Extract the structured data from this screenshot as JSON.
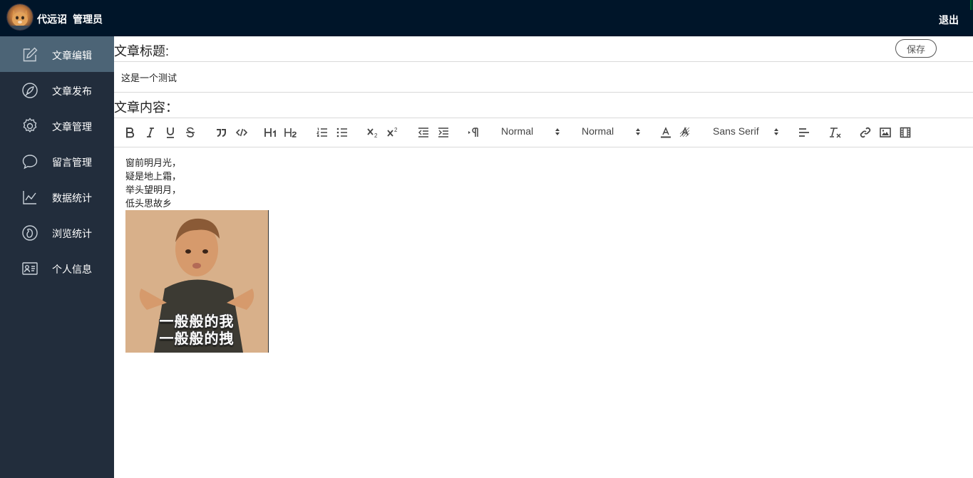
{
  "header": {
    "user_name": "代远诏",
    "user_role": "管理员",
    "logout_label": "退出"
  },
  "sidebar": {
    "items": [
      {
        "label": "文章编辑",
        "icon": "edit-icon",
        "active": true
      },
      {
        "label": "文章发布",
        "icon": "publish-icon",
        "active": false
      },
      {
        "label": "文章管理",
        "icon": "gear-icon",
        "active": false
      },
      {
        "label": "留言管理",
        "icon": "comment-icon",
        "active": false
      },
      {
        "label": "数据统计",
        "icon": "line-chart-icon",
        "active": false
      },
      {
        "label": "浏览统计",
        "icon": "footprint-icon",
        "active": false
      },
      {
        "label": "个人信息",
        "icon": "id-card-icon",
        "active": false
      }
    ]
  },
  "main": {
    "title_label": "文章标题:",
    "save_label": "保存",
    "title_value": "这是一个测试",
    "content_label": "文章内容：",
    "toolbar": {
      "header_select": "Normal",
      "size_select": "Normal",
      "font_select": "Sans Serif",
      "subscript_digit": "2",
      "superscript_digit": "2"
    },
    "editor": {
      "lines": [
        "窗前明月光，",
        "疑是地上霜，",
        "举头望明月，",
        "低头思故乡"
      ],
      "image_caption_1": "一般般的我",
      "image_caption_2": "一般般的拽"
    }
  },
  "colors": {
    "header_bg": "#001529",
    "sidebar_bg": "#222d3c",
    "sidebar_active_bg": "#4c6476"
  }
}
